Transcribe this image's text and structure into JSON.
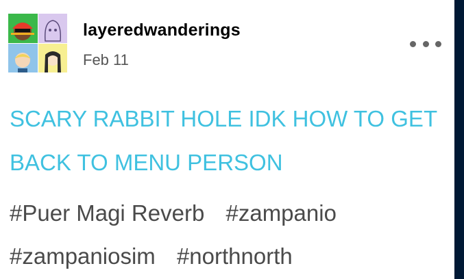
{
  "post": {
    "blog_name": "layeredwanderings",
    "date": "Feb 11",
    "body": "SCARY RABBIT HOLE IDK HOW TO GET BACK TO MENU PERSON",
    "tags": [
      "#Puer Magi Reverb",
      "#zampanio",
      "#zampaniosim",
      "#northnorth"
    ]
  },
  "icons": {
    "more": "more-horizontal-icon"
  },
  "colors": {
    "body_text": "#3fc1e0",
    "tag_text": "#4a4a4a",
    "date_text": "#555555",
    "dashboard_bg": "#001935"
  }
}
